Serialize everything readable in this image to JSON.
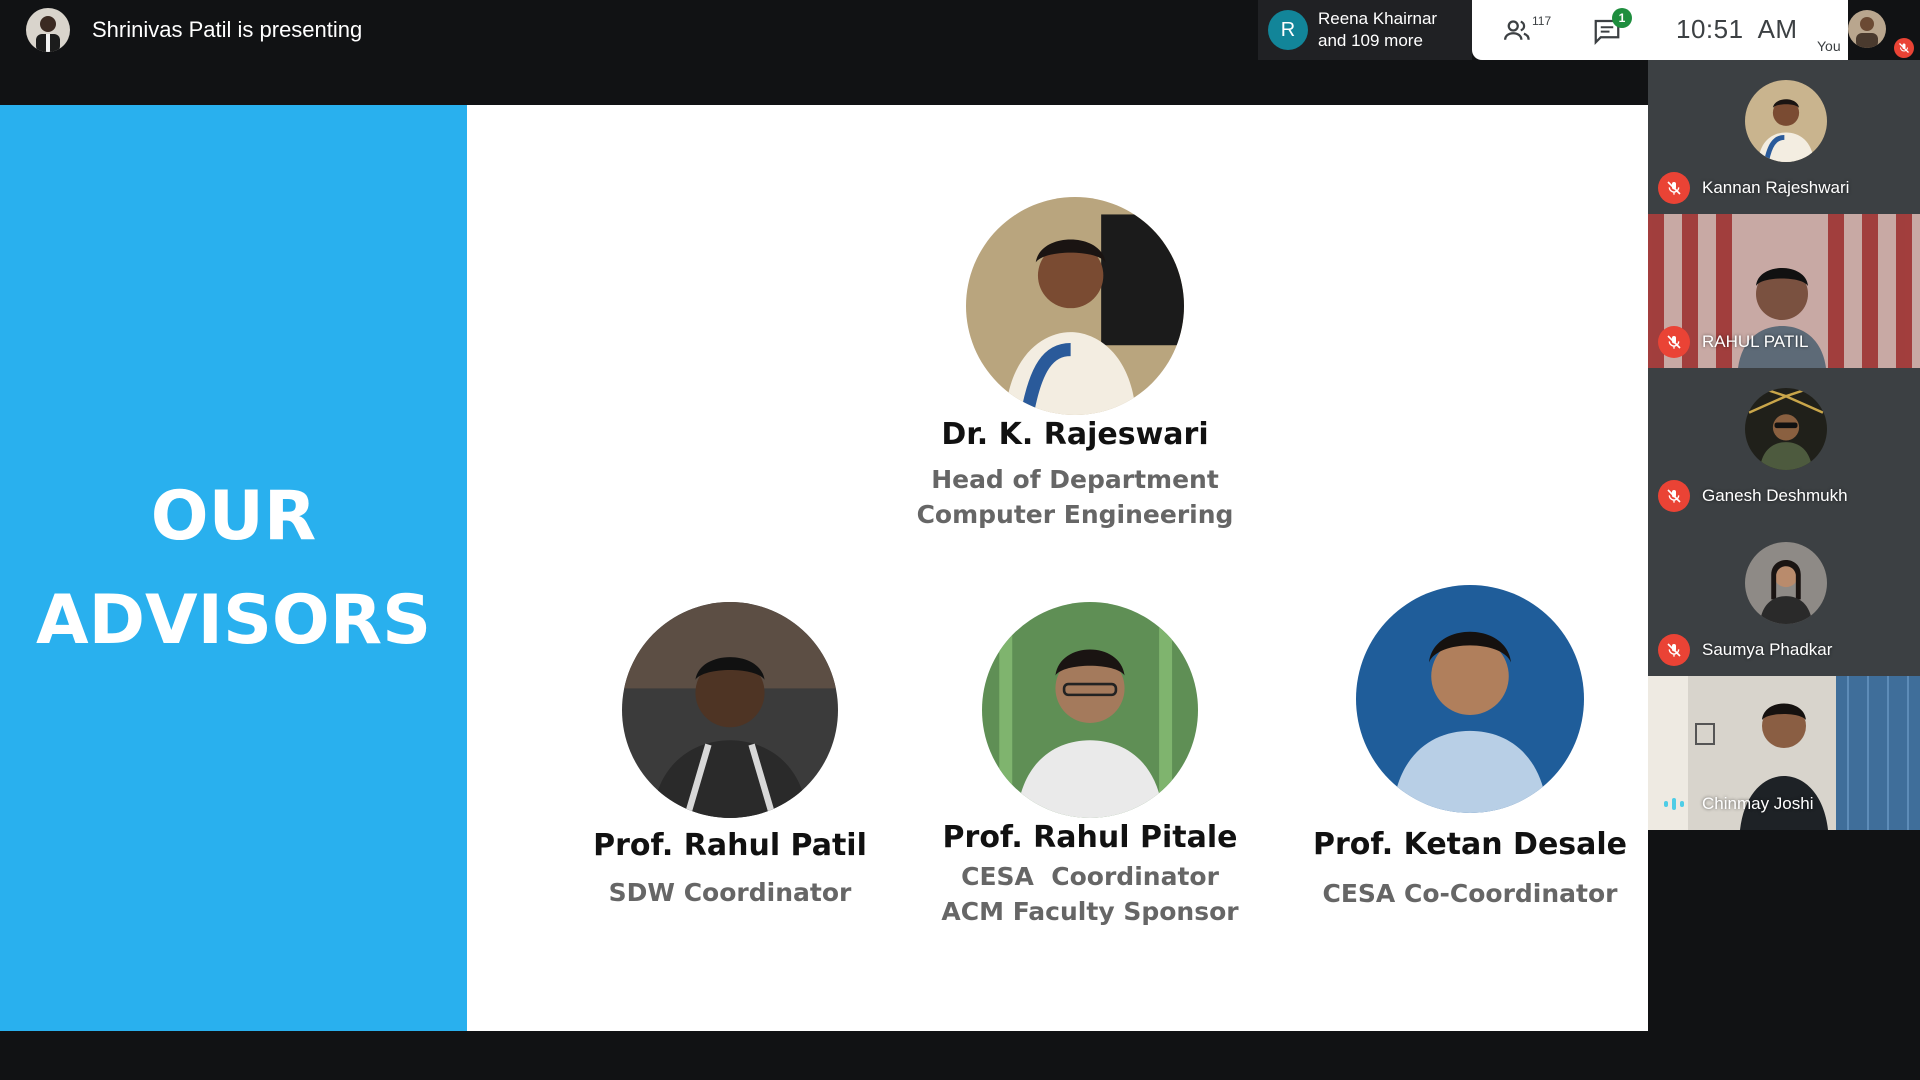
{
  "topbar": {
    "presenting_text": "Shrinivas Patil is presenting",
    "chip": {
      "initial": "R",
      "line1": "Reena Khairnar",
      "line2": "and 109 more"
    },
    "participants_count": "117",
    "chat_badge": "1",
    "time": "10:51  AM",
    "you_label": "You"
  },
  "slide": {
    "title_line1": "OUR",
    "title_line2": "ADVISORS",
    "advisors": [
      {
        "name": "Dr. K. Rajeswari",
        "role1": "Head of Department",
        "role2": "Computer Engineering"
      },
      {
        "name": "Prof. Rahul Patil",
        "role1": "SDW Coordinator",
        "role2": ""
      },
      {
        "name": "Prof. Rahul Pitale",
        "role1": "CESA  Coordinator",
        "role2": "ACM Faculty Sponsor"
      },
      {
        "name": "Prof. Ketan Desale",
        "role1": "CESA Co-Coordinator",
        "role2": ""
      }
    ]
  },
  "participants": [
    {
      "name": "Kannan Rajeshwari",
      "status": "muted"
    },
    {
      "name": "RAHUL PATIL",
      "status": "muted"
    },
    {
      "name": "Ganesh Deshmukh",
      "status": "muted"
    },
    {
      "name": "Saumya Phadkar",
      "status": "muted"
    },
    {
      "name": "Chinmay Joshi",
      "status": "speaking"
    }
  ],
  "colors": {
    "slide_accent": "#29b0ee",
    "mute_red": "#ea4335",
    "chip_teal": "#128599",
    "badge_green": "#1e8e3e"
  }
}
